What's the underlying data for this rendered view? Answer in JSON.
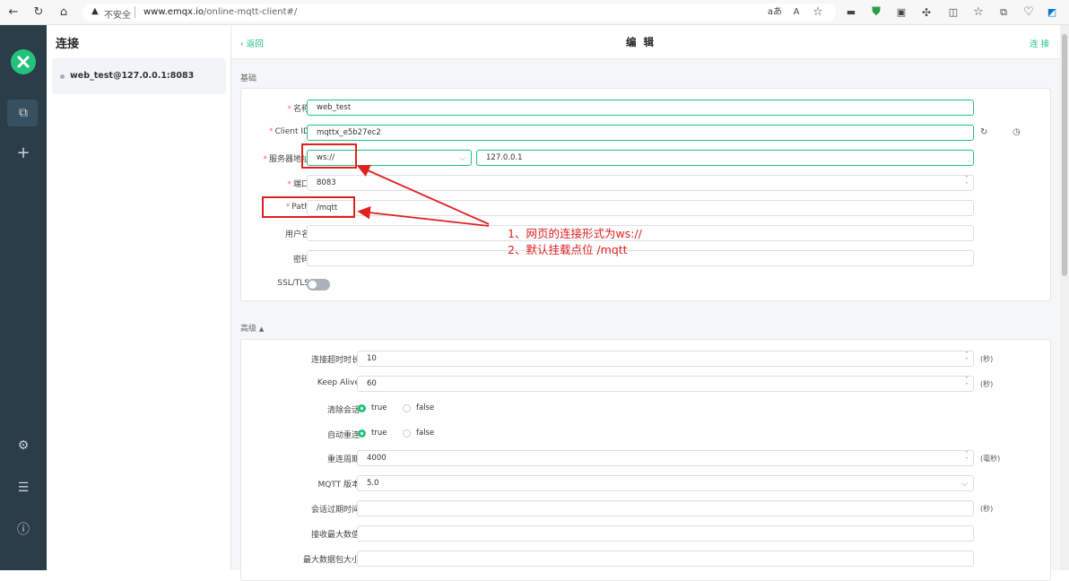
{
  "browser": {
    "insecure_label": "不安全",
    "url_host": "www.emqx.io",
    "url_path": "/online-mqtt-client#/"
  },
  "sidebar": {
    "title": "连接",
    "connection": "web_test@127.0.0.1:8083"
  },
  "header": {
    "back_label": "返回",
    "title": "编 辑",
    "connect_label": "连 接"
  },
  "basic": {
    "section_title": "基础",
    "name_label": "名称",
    "name_value": "web_test",
    "client_id_label": "Client ID",
    "client_id_value": "mqttx_e5b27ec2",
    "host_label": "服务器地址",
    "protocol_value": "ws://",
    "host_value": "127.0.0.1",
    "port_label": "端口",
    "port_value": "8083",
    "path_label": "Path",
    "path_value": "/mqtt",
    "username_label": "用户名",
    "password_label": "密码",
    "ssl_label": "SSL/TLS",
    "ssl_enabled": false
  },
  "advanced": {
    "section_title": "高级",
    "timeout_label": "连接超时时长",
    "timeout_value": "10",
    "timeout_unit": "(秒)",
    "keepalive_label": "Keep Alive",
    "keepalive_value": "60",
    "keepalive_unit": "(秒)",
    "clean_label": "清除会话",
    "reconnect_label": "自动重连",
    "true_label": "true",
    "false_label": "false",
    "reconnect_period_label": "重连周期",
    "reconnect_period_value": "4000",
    "reconnect_period_unit": "(毫秒)",
    "mqtt_version_label": "MQTT 版本",
    "mqtt_version_value": "5.0",
    "session_expiry_label": "会话过期时间",
    "session_expiry_unit": "(秒)",
    "receive_max_label": "接收最大数值",
    "max_packet_label": "最大数据包大小"
  },
  "annotation": {
    "line1": "1、网页的连接形式为ws://",
    "line2": "2、默认挂载点位 /mqtt",
    "color": "#e02020"
  },
  "colors": {
    "accent": "#22c37b",
    "rail": "#2b3d48"
  }
}
